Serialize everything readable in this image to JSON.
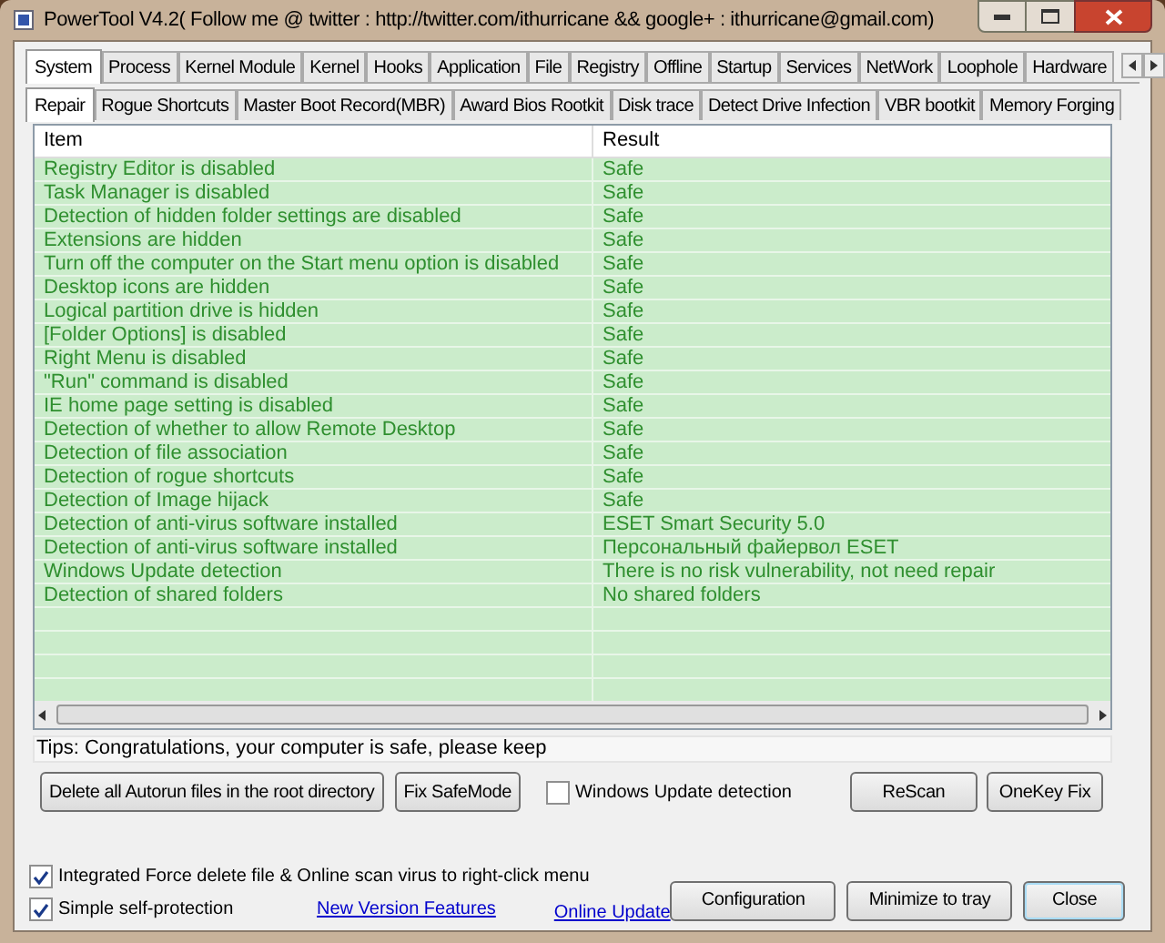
{
  "window": {
    "title": "PowerTool V4.2( Follow me @ twitter : http://twitter.com/ithurricane && google+ : ithurricane@gmail.com)"
  },
  "tabs": [
    {
      "label": "System",
      "selected": true
    },
    {
      "label": "Process",
      "selected": false
    },
    {
      "label": "Kernel Module",
      "selected": false
    },
    {
      "label": "Kernel",
      "selected": false
    },
    {
      "label": "Hooks",
      "selected": false
    },
    {
      "label": "Application",
      "selected": false
    },
    {
      "label": "File",
      "selected": false
    },
    {
      "label": "Registry",
      "selected": false
    },
    {
      "label": "Offline",
      "selected": false
    },
    {
      "label": "Startup",
      "selected": false
    },
    {
      "label": "Services",
      "selected": false
    },
    {
      "label": "NetWork",
      "selected": false
    },
    {
      "label": "Loophole",
      "selected": false
    },
    {
      "label": "Hardware",
      "selected": false
    }
  ],
  "subtabs": [
    {
      "label": "Repair",
      "selected": true
    },
    {
      "label": "Rogue Shortcuts",
      "selected": false
    },
    {
      "label": "Master Boot Record(MBR)",
      "selected": false
    },
    {
      "label": "Award Bios Rootkit",
      "selected": false
    },
    {
      "label": "Disk trace",
      "selected": false
    },
    {
      "label": "Detect Drive Infection",
      "selected": false
    },
    {
      "label": "VBR bootkit",
      "selected": false
    },
    {
      "label": "Memory Forging",
      "selected": false
    }
  ],
  "table": {
    "columns": [
      "Item",
      "Result"
    ],
    "rows": [
      {
        "item": "Registry Editor is disabled",
        "result": "Safe"
      },
      {
        "item": "Task Manager is disabled",
        "result": "Safe"
      },
      {
        "item": "Detection of hidden folder settings are disabled",
        "result": "Safe"
      },
      {
        "item": "Extensions are hidden",
        "result": "Safe"
      },
      {
        "item": "Turn off the computer on the Start menu option is disabled",
        "result": "Safe"
      },
      {
        "item": "Desktop icons are hidden",
        "result": "Safe"
      },
      {
        "item": "Logical partition drive is hidden",
        "result": "Safe"
      },
      {
        "item": "[Folder Options] is disabled",
        "result": "Safe"
      },
      {
        "item": "Right Menu is disabled",
        "result": "Safe"
      },
      {
        "item": "\"Run\" command is disabled",
        "result": "Safe"
      },
      {
        "item": "IE home page setting is disabled",
        "result": "Safe"
      },
      {
        "item": "Detection of whether to allow Remote Desktop",
        "result": "Safe"
      },
      {
        "item": "Detection of file association",
        "result": "Safe"
      },
      {
        "item": "Detection of rogue shortcuts",
        "result": "Safe"
      },
      {
        "item": "Detection of Image hijack",
        "result": "Safe"
      },
      {
        "item": "Detection of anti-virus software installed",
        "result": "ESET Smart Security 5.0"
      },
      {
        "item": "Detection of anti-virus software installed",
        "result": "Персональный файервол ESET"
      },
      {
        "item": "Windows Update detection",
        "result": "There is no risk vulnerability, not need repair"
      },
      {
        "item": "Detection of shared folders",
        "result": "No shared folders"
      }
    ]
  },
  "tips": "Tips: Congratulations, your computer is safe, please keep",
  "actions": {
    "buttons": [
      "Delete all Autorun files in the root directory",
      "Fix SafeMode"
    ],
    "checkbox": {
      "label": "Windows Update detection",
      "checked": false
    },
    "right_buttons": [
      "ReScan",
      "OneKey Fix"
    ]
  },
  "options": [
    {
      "label": "Integrated Force delete file & Online scan virus to right-click menu",
      "checked": true
    },
    {
      "label": "Simple self-protection",
      "checked": true
    }
  ],
  "links": [
    "New Version Features",
    "Online Update"
  ],
  "footer_buttons": [
    {
      "label": "Configuration",
      "selected": false
    },
    {
      "label": "Minimize to tray",
      "selected": false
    },
    {
      "label": "Close",
      "selected": true
    }
  ]
}
